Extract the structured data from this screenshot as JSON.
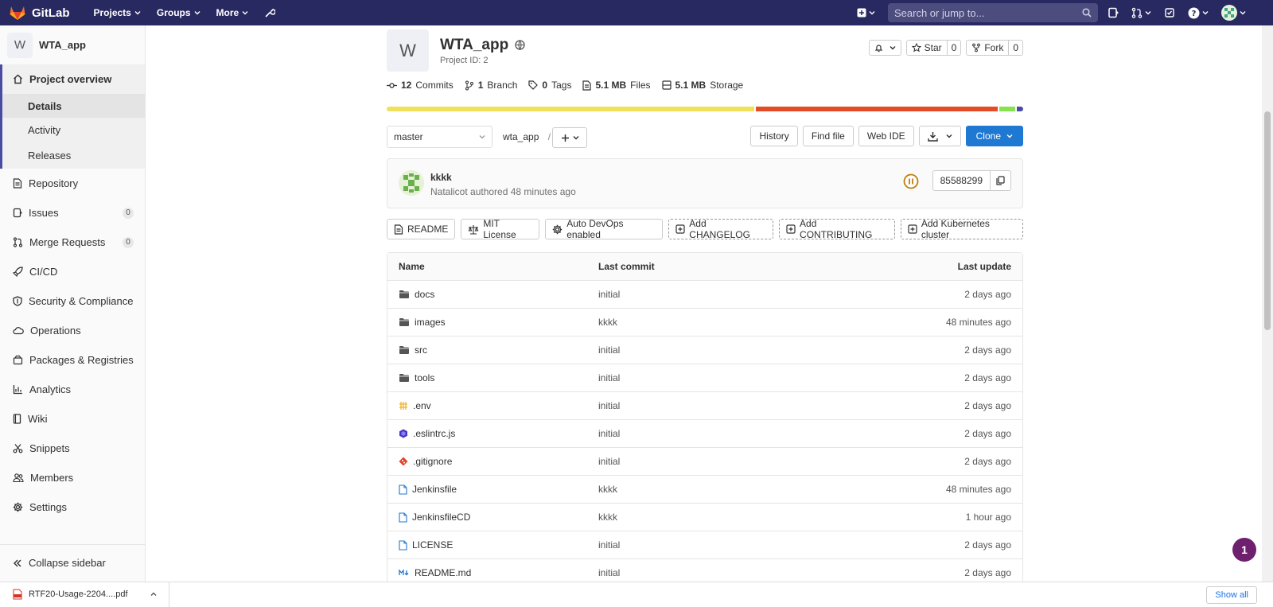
{
  "topbar": {
    "brand": "GitLab",
    "nav": [
      "Projects",
      "Groups",
      "More"
    ],
    "search_placeholder": "Search or jump to...",
    "brand_color": "#292961",
    "icons": [
      "plus-icon",
      "issues-icon",
      "merge-request-icon",
      "todo-icon",
      "help-icon",
      "user-avatar"
    ]
  },
  "sidebar": {
    "project_initial": "W",
    "project_name": "WTA_app",
    "overview": {
      "label": "Project overview",
      "subs": [
        "Details",
        "Activity",
        "Releases"
      ]
    },
    "items": [
      {
        "label": "Repository",
        "icon": "doc-icon"
      },
      {
        "label": "Issues",
        "icon": "issues-icon",
        "badge": "0"
      },
      {
        "label": "Merge Requests",
        "icon": "merge-request-icon",
        "badge": "0"
      },
      {
        "label": "CI/CD",
        "icon": "rocket-icon"
      },
      {
        "label": "Security & Compliance",
        "icon": "shield-icon"
      },
      {
        "label": "Operations",
        "icon": "cloud-icon"
      },
      {
        "label": "Packages & Registries",
        "icon": "package-icon"
      },
      {
        "label": "Analytics",
        "icon": "chart-icon"
      },
      {
        "label": "Wiki",
        "icon": "book-icon"
      },
      {
        "label": "Snippets",
        "icon": "scissors-icon"
      },
      {
        "label": "Members",
        "icon": "users-icon"
      },
      {
        "label": "Settings",
        "icon": "gear-icon"
      }
    ],
    "collapse": "Collapse sidebar"
  },
  "project": {
    "initial": "W",
    "title": "WTA_app",
    "id_label": "Project ID: 2",
    "star": "Star",
    "star_count": "0",
    "fork": "Fork",
    "fork_count": "0"
  },
  "stats": {
    "commits_n": "12",
    "commits_l": "Commits",
    "branch_n": "1",
    "branch_l": "Branch",
    "tags_n": "0",
    "tags_l": "Tags",
    "files_n": "5.1 MB",
    "files_l": "Files",
    "storage_n": "5.1 MB",
    "storage_l": "Storage"
  },
  "languages": [
    {
      "color": "#f1e05a",
      "share": 0.582
    },
    {
      "color": "#e34c26",
      "share": 0.383
    },
    {
      "color": "#89e051",
      "share": 0.025
    },
    {
      "color": "#4b4ba3",
      "share": 0.01
    }
  ],
  "toolbar": {
    "branch": "master",
    "path": "wta_app",
    "sep": "/",
    "history": "History",
    "find_file": "Find file",
    "web_ide": "Web IDE",
    "clone": "Clone",
    "clone_color": "#1f78d1"
  },
  "commit": {
    "message": "kkkk",
    "meta": "Natalicot authored 48 minutes ago",
    "sha": "85588299",
    "pipeline_color": "#c17d10"
  },
  "quick_actions": [
    {
      "label": "README",
      "icon": "doc-icon",
      "dashed": false
    },
    {
      "label": "MIT License",
      "icon": "scale-icon",
      "dashed": false
    },
    {
      "label": "Auto DevOps enabled",
      "icon": "gear-icon",
      "dashed": false
    },
    {
      "label": "Add CHANGELOG",
      "icon": "plus-square-icon",
      "dashed": true
    },
    {
      "label": "Add CONTRIBUTING",
      "icon": "plus-square-icon",
      "dashed": true
    },
    {
      "label": "Add Kubernetes cluster",
      "icon": "plus-square-icon",
      "dashed": true
    }
  ],
  "files": {
    "headers": [
      "Name",
      "Last commit",
      "Last update"
    ],
    "rows": [
      {
        "name": "docs",
        "type": "folder",
        "commit": "initial",
        "updated": "2 days ago"
      },
      {
        "name": "images",
        "type": "folder",
        "commit": "kkkk",
        "updated": "48 minutes ago"
      },
      {
        "name": "src",
        "type": "folder",
        "commit": "initial",
        "updated": "2 days ago"
      },
      {
        "name": "tools",
        "type": "folder",
        "commit": "initial",
        "updated": "2 days ago"
      },
      {
        "name": ".env",
        "type": "env",
        "commit": "initial",
        "updated": "2 days ago"
      },
      {
        "name": ".eslintrc.js",
        "type": "eslint",
        "commit": "initial",
        "updated": "2 days ago"
      },
      {
        "name": ".gitignore",
        "type": "git",
        "commit": "initial",
        "updated": "2 days ago"
      },
      {
        "name": "Jenkinsfile",
        "type": "file",
        "commit": "kkkk",
        "updated": "48 minutes ago"
      },
      {
        "name": "JenkinsfileCD",
        "type": "file",
        "commit": "kkkk",
        "updated": "1 hour ago"
      },
      {
        "name": "LICENSE",
        "type": "file",
        "commit": "initial",
        "updated": "2 days ago"
      },
      {
        "name": "README.md",
        "type": "markdown",
        "commit": "initial",
        "updated": "2 days ago"
      }
    ]
  },
  "help_badge": "1",
  "download": {
    "file": "RTF20-Usage-2204....pdf",
    "show_all": "Show all"
  }
}
